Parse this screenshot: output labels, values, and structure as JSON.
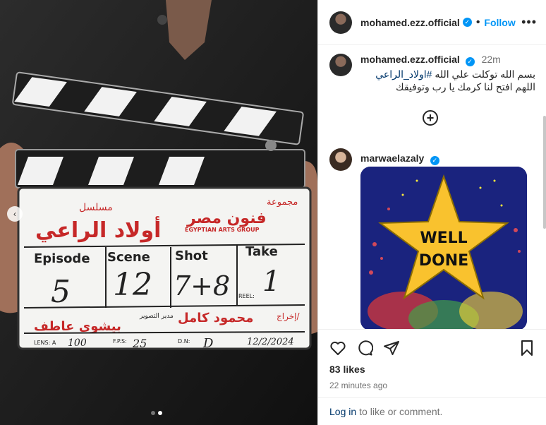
{
  "post": {
    "username": "mohamed.ezz.official",
    "separator": "•",
    "follow_label": "Follow",
    "more_label": "•••",
    "caption_time": "22m",
    "caption_text": "بسم الله توكلت علي الله",
    "caption_hashtag": "#اولاد_الراعي",
    "caption_text_after": "اللهم افتح لنا كرمك يا رب وتوفيقك",
    "load_more_label": "+",
    "comment_username": "marwaelazaly",
    "sticker_text_line1": "WELL",
    "sticker_text_line2": "DONE",
    "likes": "83 likes",
    "posted_ago": "22 minutes ago",
    "login_link": "Log in",
    "login_rest": "to like or comment."
  },
  "media": {
    "slate_series_label": "مسلسل",
    "slate_title": "أولاد الراعي",
    "slate_company_label": "مجموعة",
    "slate_company": "فنون مصر",
    "slate_company_en": "EGYPTIAN ARTS GROUP",
    "slate_col_episode": "Episode",
    "slate_col_scene": "Scene",
    "slate_col_shot": "Shot",
    "slate_col_take": "Take",
    "slate_val_episode": "5",
    "slate_val_scene": "12",
    "slate_val_shot": "7+8",
    "slate_val_take": "1",
    "slate_reel": "REEL:",
    "slate_director_label": "إخراج/",
    "slate_director": "محمود كامل",
    "slate_dop_label": "مدير التصوير",
    "slate_dop": "بيشوي عاطف",
    "slate_lens": "LENS: A",
    "slate_lens_val": "100",
    "slate_fps": "F.P.S:",
    "slate_fps_val": "25",
    "slate_dn": "D.N:",
    "slate_dn_val": "D",
    "slate_date": "12/2/2024",
    "nav_prev": "‹",
    "slide_count": 2,
    "active_slide": 2
  },
  "colors": {
    "accent": "#0095f6",
    "link": "#00376b",
    "muted": "#737373",
    "slate_red": "#c62828"
  },
  "icons": [
    "verified-badge-icon",
    "more-icon",
    "plus-circle-icon",
    "heart-icon",
    "comment-icon",
    "share-icon",
    "bookmark-icon",
    "chevron-left-icon"
  ]
}
